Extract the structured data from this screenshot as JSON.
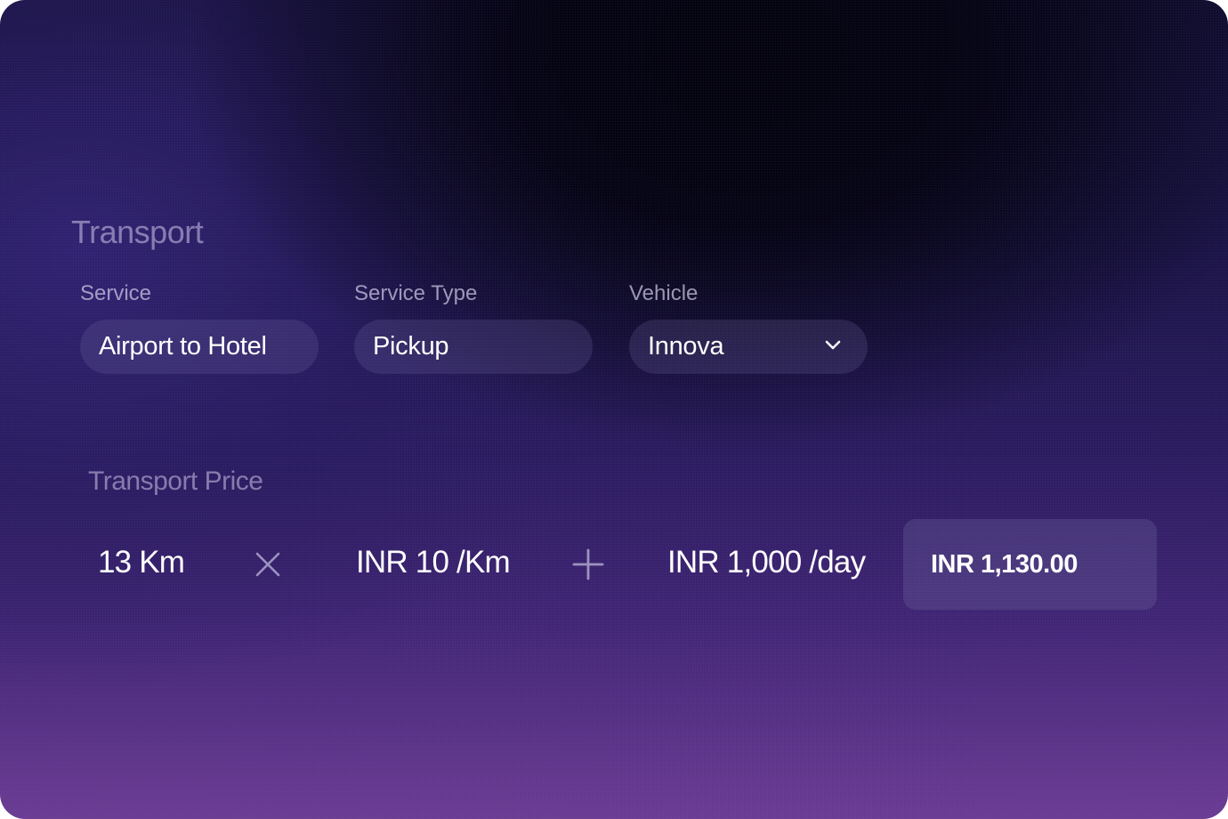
{
  "transport": {
    "title": "Transport",
    "service": {
      "label": "Service",
      "value": "Airport to Hotel"
    },
    "service_type": {
      "label": "Service Type",
      "value": "Pickup"
    },
    "vehicle": {
      "label": "Vehicle",
      "value": "Innova",
      "icon": "chevron-down-icon"
    }
  },
  "price": {
    "title": "Transport Price",
    "distance": "13 Km",
    "multiply_icon": "multiply-icon",
    "rate": "INR 10 /Km",
    "plus_icon": "plus-icon",
    "daily": "INR 1,000 /day",
    "total": "INR 1,130.00"
  }
}
